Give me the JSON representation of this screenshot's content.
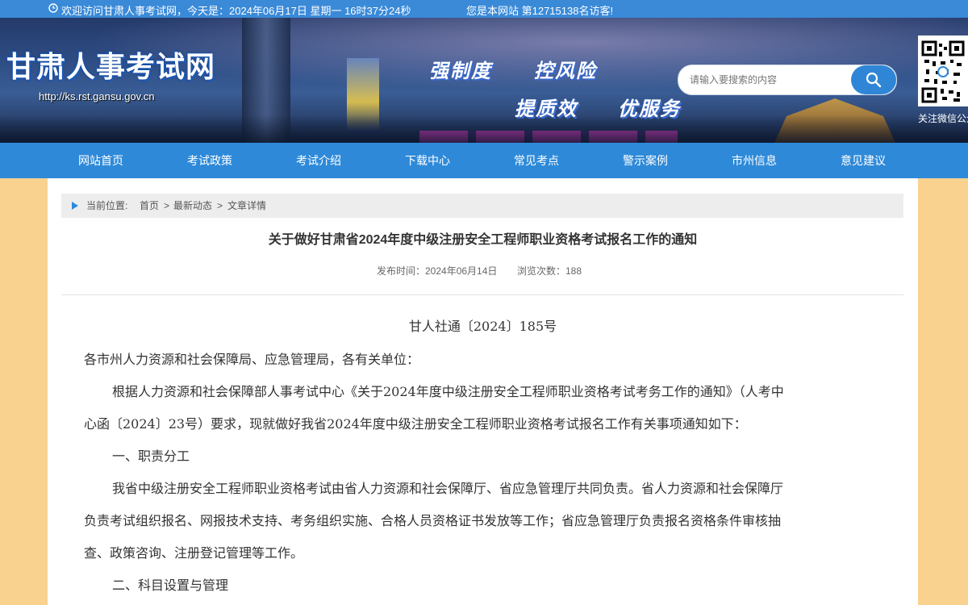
{
  "topbar": {
    "welcome": "欢迎访问甘肃人事考试网，今天是：2024年06月17日 星期一 16时37分24秒",
    "visitors": "您是本网站 第12715138名访客!"
  },
  "header": {
    "site_title": "甘肃人事考试网",
    "site_url": "http://ks.rst.gansu.gov.cn",
    "slogans": [
      "强制度",
      "控风险",
      "提质效",
      "优服务"
    ],
    "search_placeholder": "请输入要搜索的内容",
    "qr_label": "关注微信公众号"
  },
  "nav": {
    "items": [
      "网站首页",
      "考试政策",
      "考试介绍",
      "下载中心",
      "常见考点",
      "警示案例",
      "市州信息",
      "意见建议"
    ]
  },
  "breadcrumb": {
    "label": "当前位置:",
    "items": [
      "首页",
      "最新动态",
      "文章详情"
    ],
    "sep": ">"
  },
  "article": {
    "title": "关于做好甘肃省2024年度中级注册安全工程师职业资格考试报名工作的通知",
    "publish": "发布时间：2024年06月14日",
    "views": "浏览次数：188",
    "doc_no": "甘人社通〔2024〕185号",
    "lines": [
      "各市州人力资源和社会保障局、应急管理局，各有关单位：",
      "根据人力资源和社会保障部人事考试中心《关于2024年度中级注册安全工程师职业资格考试考务工作的通知》（人考中",
      "心函〔2024〕23号）要求，现就做好我省2024年度中级注册安全工程师职业资格考试报名工作有关事项通知如下：",
      "一、职责分工",
      "我省中级注册安全工程师职业资格考试由省人力资源和社会保障厅、省应急管理厅共同负责。省人力资源和社会保障厅",
      "负责考试组织报名、网报技术支持、考务组织实施、合格人员资格证书发放等工作；省应急管理厅负责报名资格条件审核抽",
      "查、政策咨询、注册登记管理等工作。",
      "二、科目设置与管理"
    ]
  },
  "colors": {
    "nav_bg": "#2e8ad9",
    "topbar_bg": "#3a8ad8",
    "page_bg": "#f9d290"
  }
}
